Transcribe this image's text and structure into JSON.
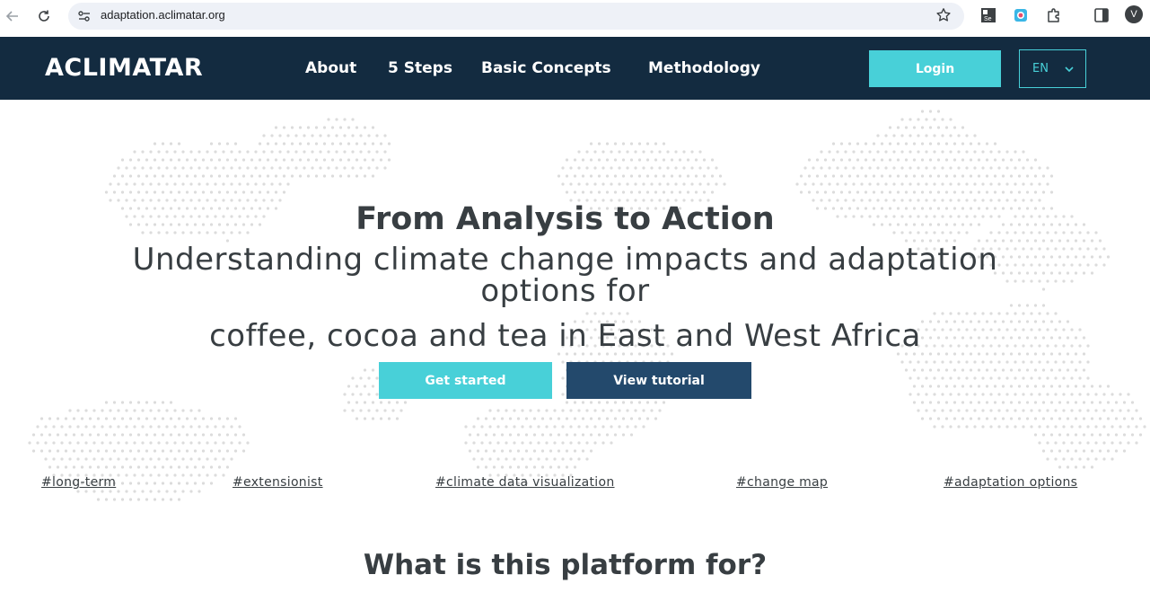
{
  "browser": {
    "url": "adaptation.aclimatar.org",
    "profile_initial": "V",
    "icons": [
      "back-arrow-icon",
      "reload-icon",
      "site-info-icon",
      "bookmark-star-icon",
      "selenium-extension-icon",
      "camera-extension-icon",
      "extensions-puzzle-icon",
      "side-panel-icon"
    ]
  },
  "header": {
    "logo": "ACLIMATAR",
    "menu": [
      {
        "label": "About"
      },
      {
        "label": "5 Steps"
      },
      {
        "label": "Basic Concepts"
      },
      {
        "label": "Methodology"
      }
    ],
    "login_label": "Login",
    "language": "EN"
  },
  "hero": {
    "title": "From Analysis to Action",
    "subtitle_line1": "Understanding climate change impacts and adaptation options for",
    "subtitle_line2": "coffee, cocoa and tea in East and West Africa",
    "get_started_label": "Get started",
    "tutorial_label": "View tutorial",
    "tags": [
      "#long-term",
      "#extensionist",
      "#climate data visualization",
      "#change map",
      "#adaptation options"
    ]
  },
  "section": {
    "title": "What is this platform for?"
  },
  "colors": {
    "header_bg": "#132b40",
    "accent": "#48d0d8",
    "tutorial_bg": "#23496c",
    "text": "#383e42",
    "dots": "#dcdcdc"
  }
}
